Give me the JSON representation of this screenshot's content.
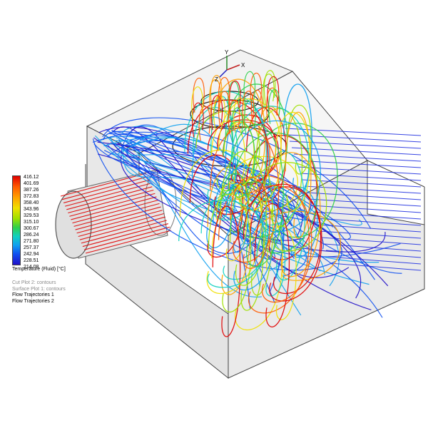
{
  "legend": {
    "values": [
      "416.12",
      "401.69",
      "387.26",
      "372.83",
      "358.40",
      "343.96",
      "329.53",
      "315.10",
      "300.67",
      "286.24",
      "271.80",
      "257.37",
      "242.94",
      "228.51",
      "214.08"
    ],
    "title": "Temperature (Fluid) [°C]",
    "colors": [
      "#e00000",
      "#ff5a00",
      "#ffa000",
      "#f0e000",
      "#9ee000",
      "#2fd04a",
      "#10d0c0",
      "#10a0f0",
      "#1050f0",
      "#2010c8"
    ]
  },
  "plots": [
    {
      "label": "Cut Plot 2: contours",
      "active": false
    },
    {
      "label": "Surface Plot 1: contours",
      "active": false
    },
    {
      "label": "Flow Trajectories 1",
      "active": true
    },
    {
      "label": "Flow Trajectories 2",
      "active": true
    }
  ],
  "triad": {
    "y": "Y",
    "x": "X",
    "z": "Z"
  }
}
